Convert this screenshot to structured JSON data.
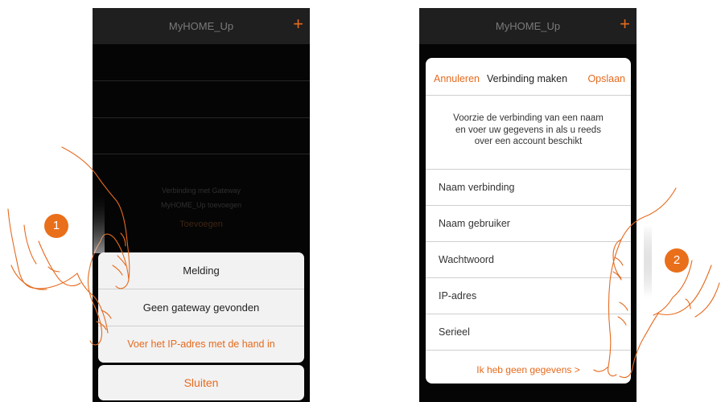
{
  "screen1": {
    "app_title": "MyHOME_Up",
    "add_icon": "plus-icon",
    "empty_text_line1": "Verbinding met Gateway",
    "empty_text_line2": "MyHOME_Up toevoegen",
    "add_link": "Toevoegen",
    "alert": {
      "title": "Melding",
      "message": "Geen gateway gevonden",
      "manual_ip_link": "Voer het IP-adres met de hand in"
    },
    "close_button": "Sluiten",
    "step_badge": "1"
  },
  "screen2": {
    "app_title": "MyHOME_Up",
    "add_icon": "plus-icon",
    "header": {
      "cancel": "Annuleren",
      "title": "Verbinding maken",
      "save": "Opslaan"
    },
    "intro_line1": "Voorzie de verbinding van een naam",
    "intro_line2": "en voer uw gegevens in als u reeds",
    "intro_line3": "over een account beschikt",
    "fields": {
      "connection_name": "Naam verbinding",
      "user_name": "Naam gebruiker",
      "password": "Wachtwoord",
      "ip_address": "IP-adres",
      "serial": "Serieel"
    },
    "no_data_link": "Ik heb geen gegevens >",
    "step_badge": "2"
  },
  "colors": {
    "accent": "#e56a1e",
    "badge": "#e96f1b",
    "phone_background": "#050505",
    "topbar": "#1f1f1f"
  }
}
